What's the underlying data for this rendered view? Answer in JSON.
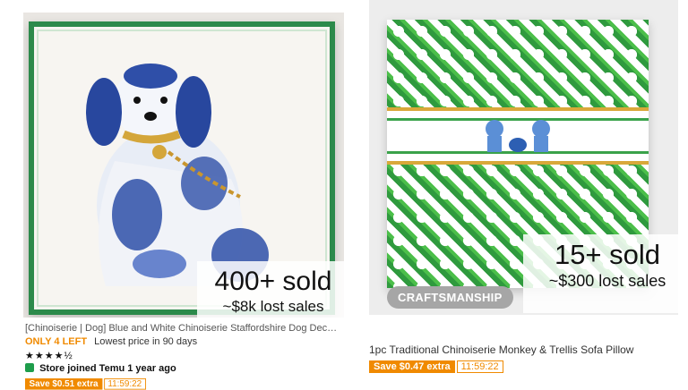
{
  "cards": [
    {
      "photo": "pillow-dog",
      "overlay": {
        "sold": "400+ sold",
        "lost": "~$8k lost sales"
      },
      "title": "[Chinoiserie | Dog] Blue and White Chinoiserie Staffordshire Dog Decor...",
      "stock": "ONLY 4 LEFT",
      "lowest": "Lowest price in 90 days",
      "stars": "★★★★½",
      "store": "Store joined Temu 1 year ago",
      "promo": {
        "save": "Save $0.51 extra",
        "timer": "11:59:22"
      }
    },
    {
      "photo": "pillow-trellis",
      "badge": "CRAFTSMANSHIP",
      "overlay": {
        "sold": "15+ sold",
        "lost": "~$300 lost sales"
      },
      "title": "1pc Traditional Chinoiserie Monkey & Trellis Sofa Pillow",
      "promo": {
        "save": "Save $0.47 extra",
        "timer": "11:59:22"
      }
    }
  ],
  "colors": {
    "accent_orange": "#f08a00",
    "green": "#2c8a4b"
  }
}
